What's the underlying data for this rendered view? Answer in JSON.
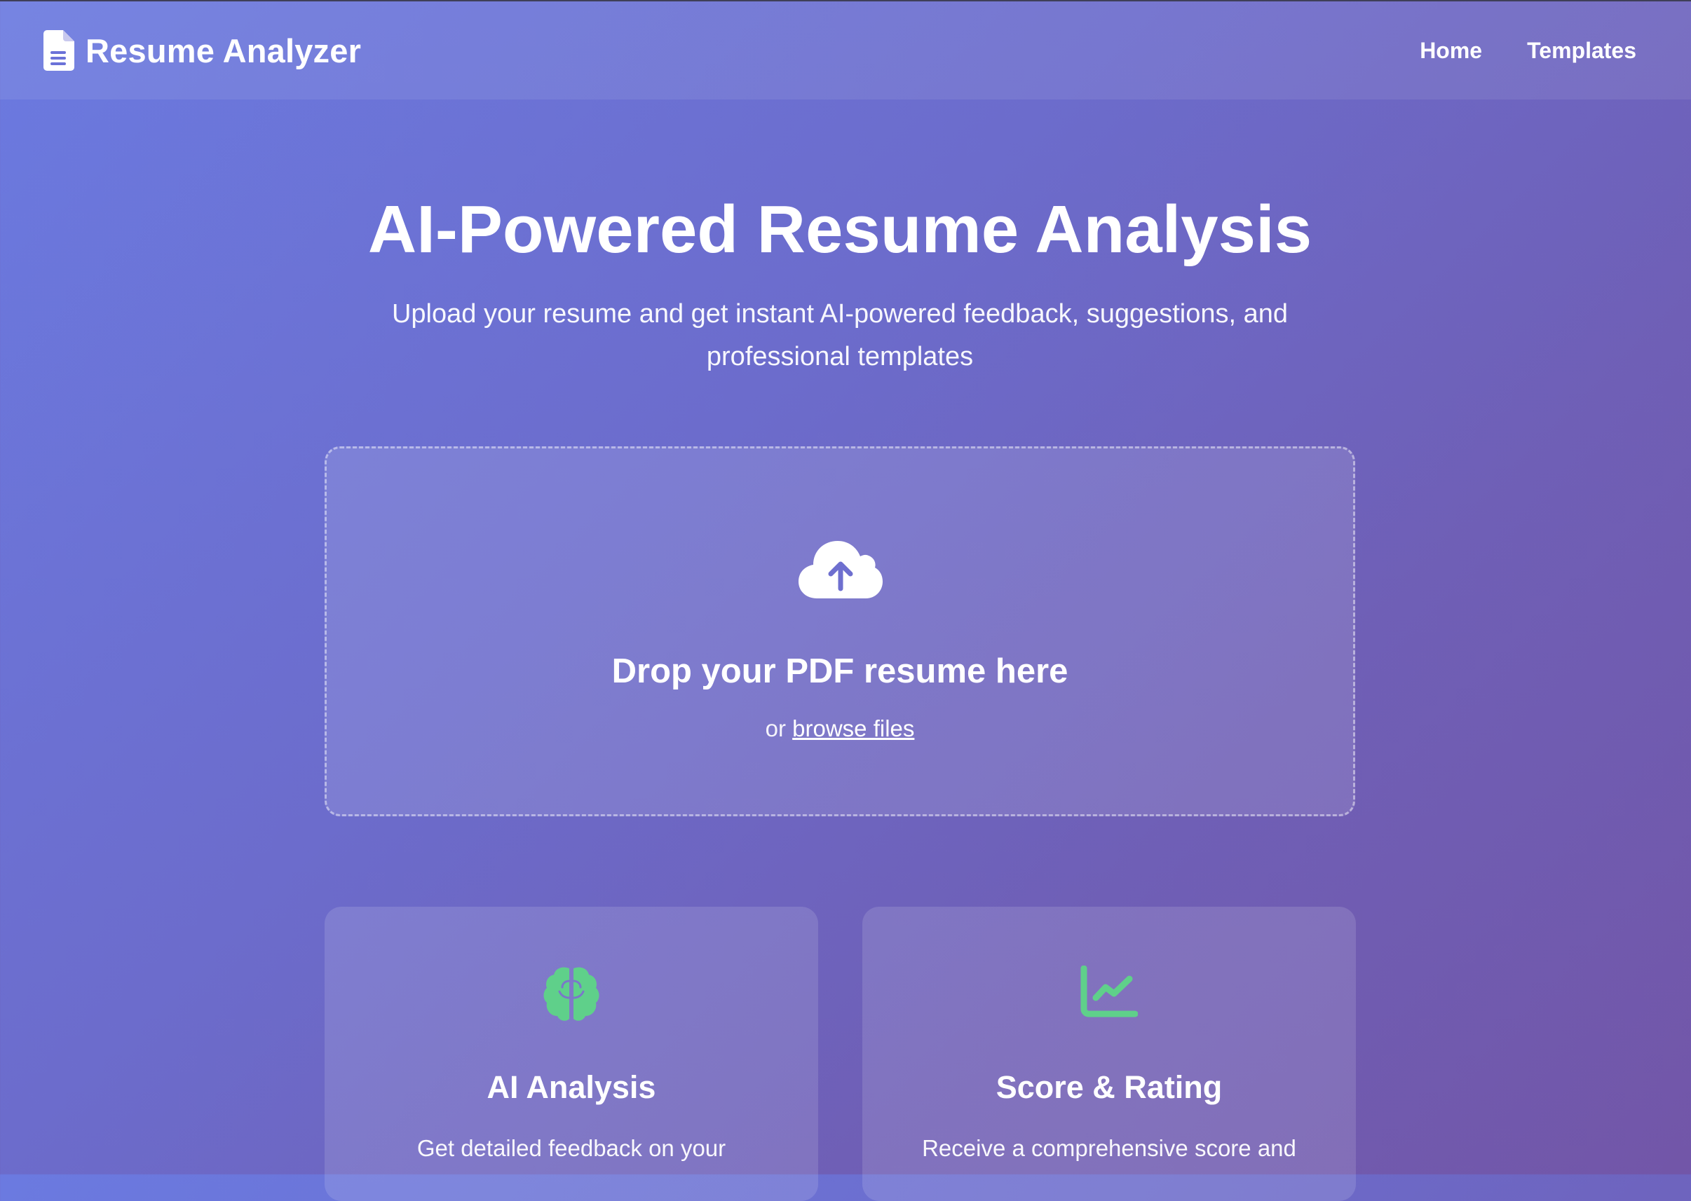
{
  "header": {
    "logo_icon": "document-icon",
    "title": "Resume Analyzer",
    "nav": [
      {
        "label": "Home"
      },
      {
        "label": "Templates"
      }
    ]
  },
  "hero": {
    "title": "AI-Powered Resume Analysis",
    "subtitle": "Upload your resume and get instant AI-powered feedback, suggestions, and professional templates"
  },
  "upload": {
    "icon": "cloud-upload-icon",
    "title": "Drop your PDF resume here",
    "or_text": "or",
    "browse_label": "browse files"
  },
  "features": [
    {
      "icon": "brain-icon",
      "title": "AI Analysis",
      "description": "Get detailed feedback on your"
    },
    {
      "icon": "chart-line-icon",
      "title": "Score & Rating",
      "description": "Receive a comprehensive score and"
    }
  ],
  "colors": {
    "accent_green": "#5fd08a",
    "gradient_start": "#6b7ae0",
    "gradient_end": "#7256a8"
  }
}
